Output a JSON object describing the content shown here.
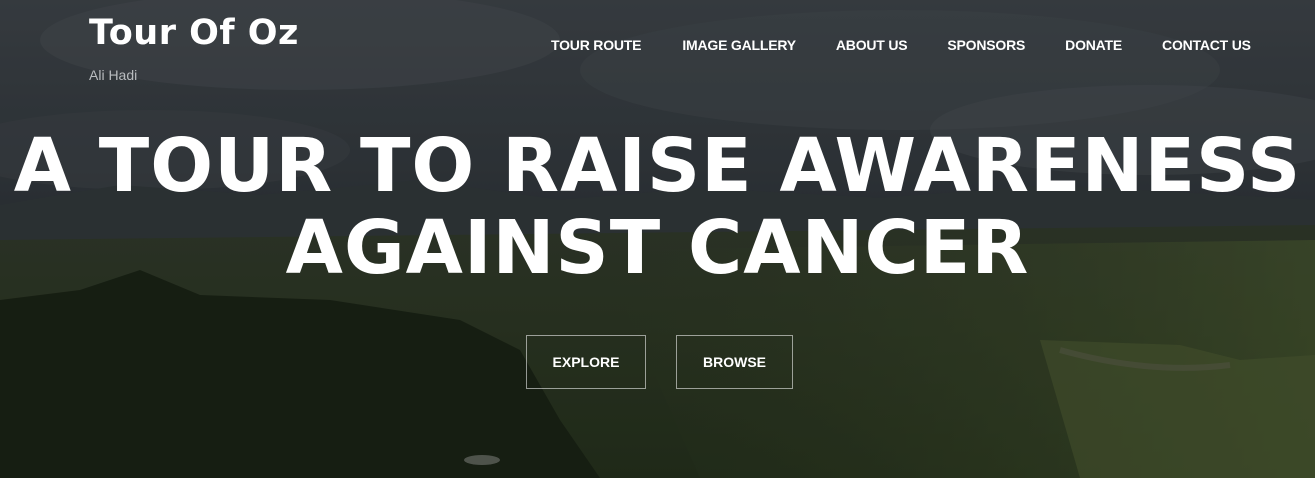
{
  "brand": {
    "title": "Tour Of Oz",
    "subtitle": "Ali Hadi"
  },
  "nav": {
    "items": [
      {
        "label": "TOUR ROUTE"
      },
      {
        "label": "IMAGE GALLERY"
      },
      {
        "label": "ABOUT US"
      },
      {
        "label": "SPONSORS"
      },
      {
        "label": "DONATE"
      },
      {
        "label": "CONTACT US"
      }
    ]
  },
  "hero": {
    "headline_line1": "A TOUR TO RAISE AWARENESS",
    "headline_line2": "AGAINST CANCER",
    "explore_label": "EXPLORE",
    "browse_label": "BROWSE",
    "background_image": "aerial-landscape-photo"
  },
  "colors": {
    "text": "#ffffff",
    "subtitle": "#b9bcbf",
    "sky": "#3e464d",
    "land": "#3c4a2d"
  }
}
